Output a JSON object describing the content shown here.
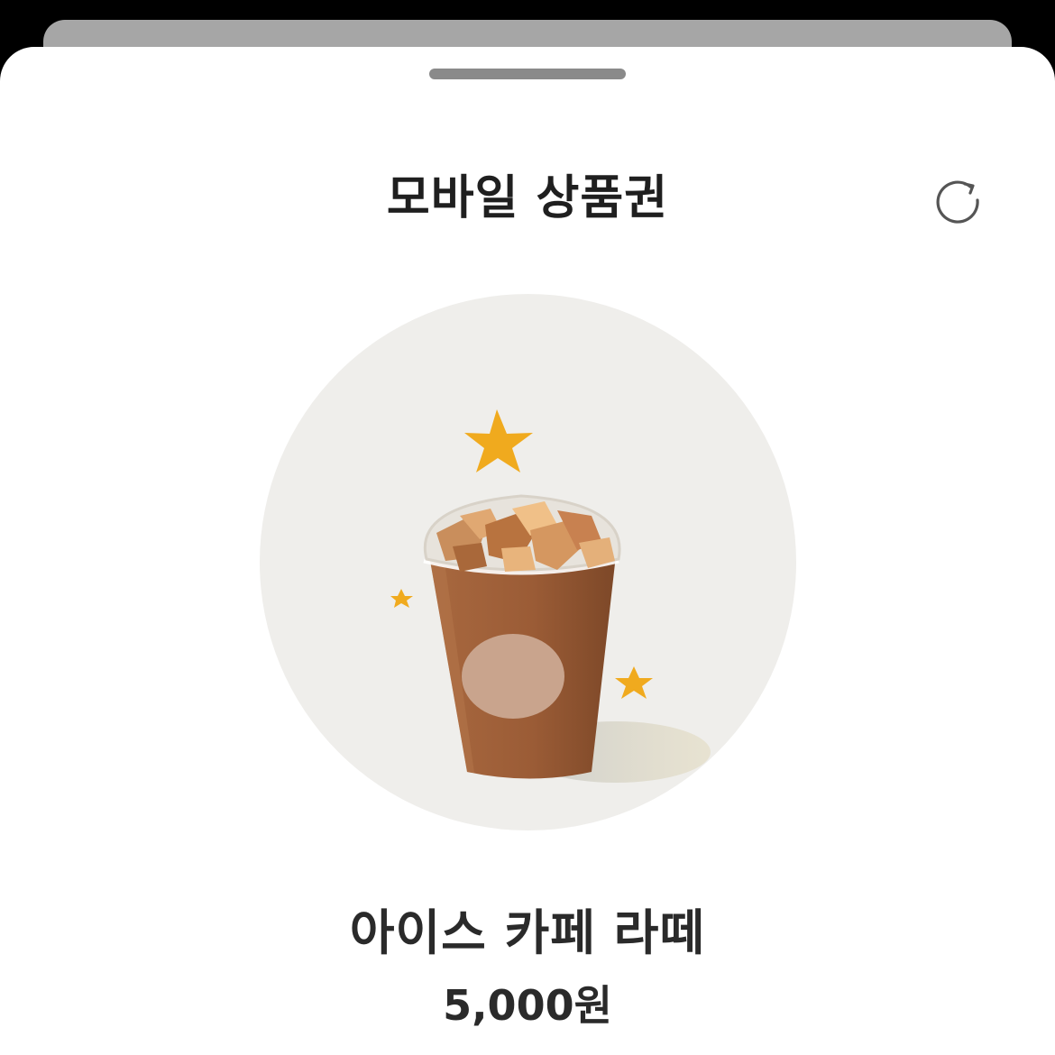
{
  "sheet": {
    "title": "모바일 상품권"
  },
  "icons": {
    "refresh": "refresh-icon",
    "drag_handle": "grabber"
  },
  "product": {
    "name": "아이스 카페 라떼",
    "price": "5,000원",
    "image": "iced-cafe-latte-illustration"
  },
  "colors": {
    "sheet_background": "#ffffff",
    "circle_background": "#efeeeb",
    "cup": "#9a5a35",
    "star": "#f0aa1e",
    "text": "#2a2a2a"
  }
}
